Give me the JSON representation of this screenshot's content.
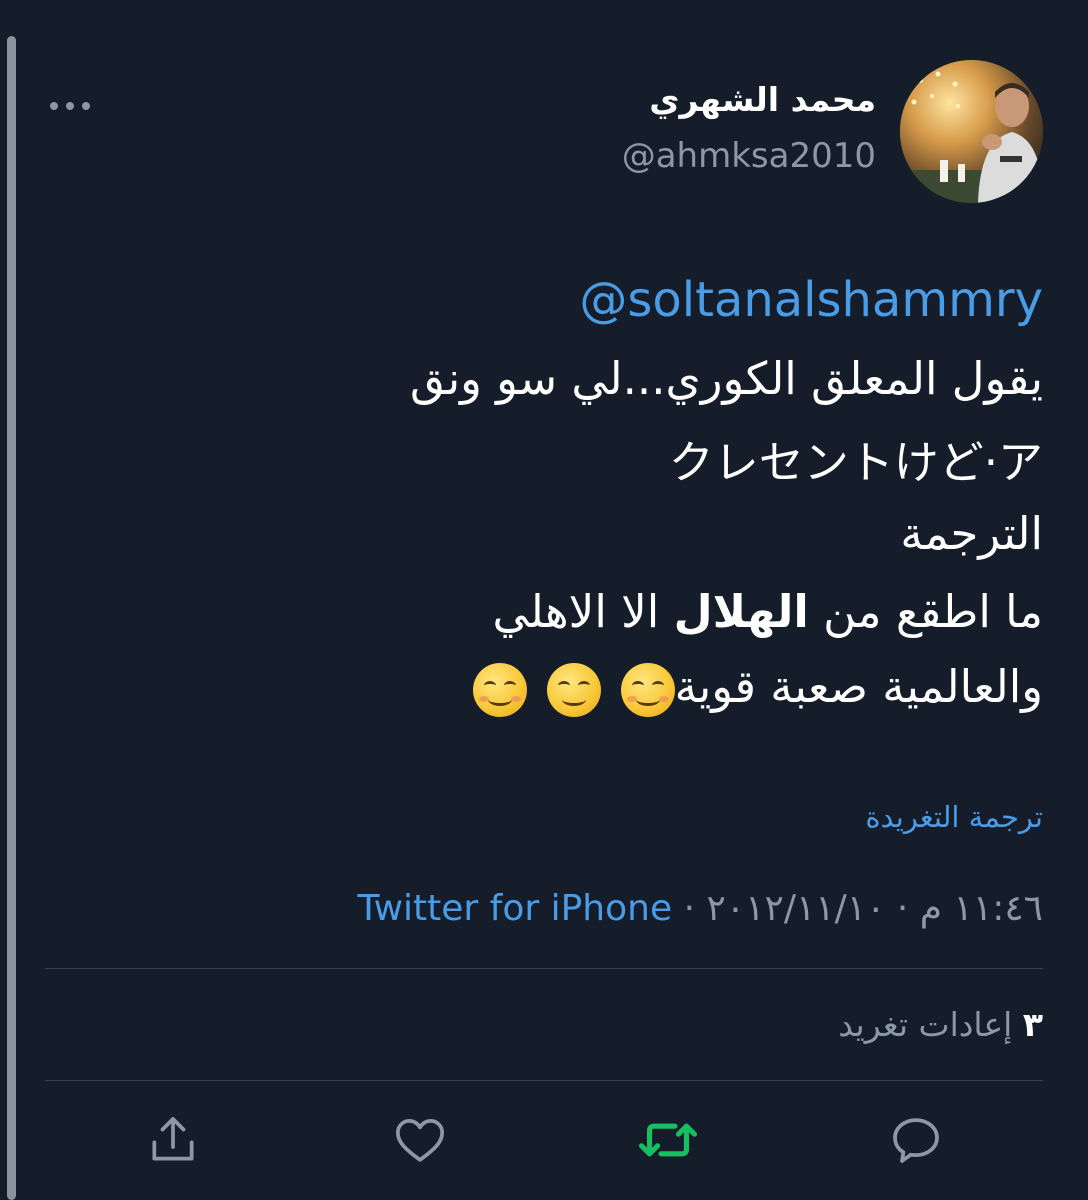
{
  "author": {
    "name": "محمد الشهري",
    "handle": "@ahmksa2010"
  },
  "tweet": {
    "mention": "@soltanalshammry",
    "line1": "يقول المعلق الكوري...لي سو ونق",
    "line2": "クレセントけど·ア",
    "line3": "الترجمة",
    "line4_part1": "ما اطقع من",
    "line4_bold": "الهلال",
    "line4_part2": "الا الاهلي",
    "line5": "والعالمية صعبة قوية",
    "emojis": [
      "smiling-face-icon",
      "winking-face-icon",
      "blushing-face-icon"
    ]
  },
  "translate_link": "ترجمة التغريدة",
  "meta": {
    "date": "٢٠١٢/١١/١٠",
    "time": "١١:٤٦ م",
    "separator": "·",
    "source": "Twitter for iPhone"
  },
  "stats": {
    "retweets_count": "٣",
    "retweets_label": "إعادات تغريد"
  },
  "actions": [
    {
      "name": "reply",
      "icon": "comment-icon"
    },
    {
      "name": "retweet",
      "icon": "retweet-icon",
      "color": "#17bf63"
    },
    {
      "name": "like",
      "icon": "heart-icon"
    },
    {
      "name": "share",
      "icon": "share-icon"
    }
  ],
  "colors": {
    "background": "#161d2a",
    "link": "#4a9ce6",
    "muted": "#8b98a5",
    "retweet_active": "#17bf63"
  }
}
